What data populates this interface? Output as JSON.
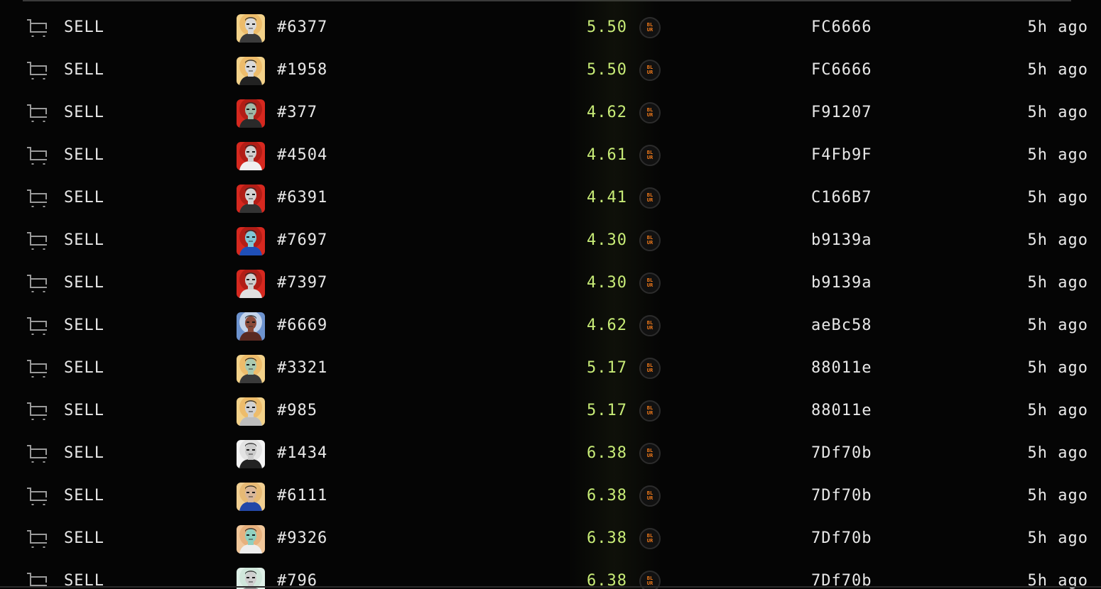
{
  "colors": {
    "background": "#050505",
    "price": "#c8ec77",
    "text": "#e8e8e8",
    "blur_logo": "#f07a1a"
  },
  "currency_badge": {
    "icon": "blur-logo-icon",
    "line1": "BL",
    "line2": "UR"
  },
  "activity": {
    "rows": [
      {
        "event": "SELL",
        "token": "#6377",
        "price": "5.50",
        "address": "FC6666",
        "time": "5h ago",
        "avatar_bg": "#f3d28a",
        "avatar_accent": "#e9b25e",
        "skin": "#d9d9d9",
        "shirt": "#3b3b3b"
      },
      {
        "event": "SELL",
        "token": "#1958",
        "price": "5.50",
        "address": "FC6666",
        "time": "5h ago",
        "avatar_bg": "#f3d28a",
        "avatar_accent": "#e9b25e",
        "skin": "#d8d8d8",
        "shirt": "#222222"
      },
      {
        "event": "SELL",
        "token": "#377",
        "price": "4.62",
        "address": "F91207",
        "time": "5h ago",
        "avatar_bg": "#d6281f",
        "avatar_accent": "#a31812",
        "skin": "#9fb8a8",
        "shirt": "#2a2a2a"
      },
      {
        "event": "SELL",
        "token": "#4504",
        "price": "4.61",
        "address": "F4Fb9F",
        "time": "5h ago",
        "avatar_bg": "#d6281f",
        "avatar_accent": "#a31812",
        "skin": "#cfcfcf",
        "shirt": "#efefef"
      },
      {
        "event": "SELL",
        "token": "#6391",
        "price": "4.41",
        "address": "C166B7",
        "time": "5h ago",
        "avatar_bg": "#d6281f",
        "avatar_accent": "#a31812",
        "skin": "#d2d2d2",
        "shirt": "#333333"
      },
      {
        "event": "SELL",
        "token": "#7697",
        "price": "4.30",
        "address": "b9139a",
        "time": "5h ago",
        "avatar_bg": "#d6281f",
        "avatar_accent": "#a31812",
        "skin": "#7fc6d6",
        "shirt": "#1f4fb8"
      },
      {
        "event": "SELL",
        "token": "#7397",
        "price": "4.30",
        "address": "b9139a",
        "time": "5h ago",
        "avatar_bg": "#d6281f",
        "avatar_accent": "#a31812",
        "skin": "#cdcdcd",
        "shirt": "#e0e0e0"
      },
      {
        "event": "SELL",
        "token": "#6669",
        "price": "4.62",
        "address": "aeBc58",
        "time": "5h ago",
        "avatar_bg": "#6d93cf",
        "avatar_accent": "#e8f0f8",
        "skin": "#8a4a3a",
        "shirt": "#5a2a22"
      },
      {
        "event": "SELL",
        "token": "#3321",
        "price": "5.17",
        "address": "88011e",
        "time": "5h ago",
        "avatar_bg": "#f3d28a",
        "avatar_accent": "#e9b25e",
        "skin": "#a9c9b0",
        "shirt": "#3a3a3a"
      },
      {
        "event": "SELL",
        "token": "#985",
        "price": "5.17",
        "address": "88011e",
        "time": "5h ago",
        "avatar_bg": "#f3d28a",
        "avatar_accent": "#e9b25e",
        "skin": "#d0d0d0",
        "shirt": "#bdbdbd"
      },
      {
        "event": "SELL",
        "token": "#1434",
        "price": "6.38",
        "address": "7Df70b",
        "time": "5h ago",
        "avatar_bg": "#f4f4f4",
        "avatar_accent": "#dcdcdc",
        "skin": "#cccccc",
        "shirt": "#222222"
      },
      {
        "event": "SELL",
        "token": "#6111",
        "price": "6.38",
        "address": "7Df70b",
        "time": "5h ago",
        "avatar_bg": "#f1cf92",
        "avatar_accent": "#e3b06a",
        "skin": "#d9b79a",
        "shirt": "#2448a8"
      },
      {
        "event": "SELL",
        "token": "#9326",
        "price": "6.38",
        "address": "7Df70b",
        "time": "5h ago",
        "avatar_bg": "#f1c79a",
        "avatar_accent": "#e2a872",
        "skin": "#8fd0c0",
        "shirt": "#eeeeee"
      },
      {
        "event": "SELL",
        "token": "#796",
        "price": "6.38",
        "address": "7Df70b",
        "time": "5h ago",
        "avatar_bg": "#dff0e8",
        "avatar_accent": "#c9e2d6",
        "skin": "#cfcfcf",
        "shirt": "#888888"
      }
    ]
  }
}
